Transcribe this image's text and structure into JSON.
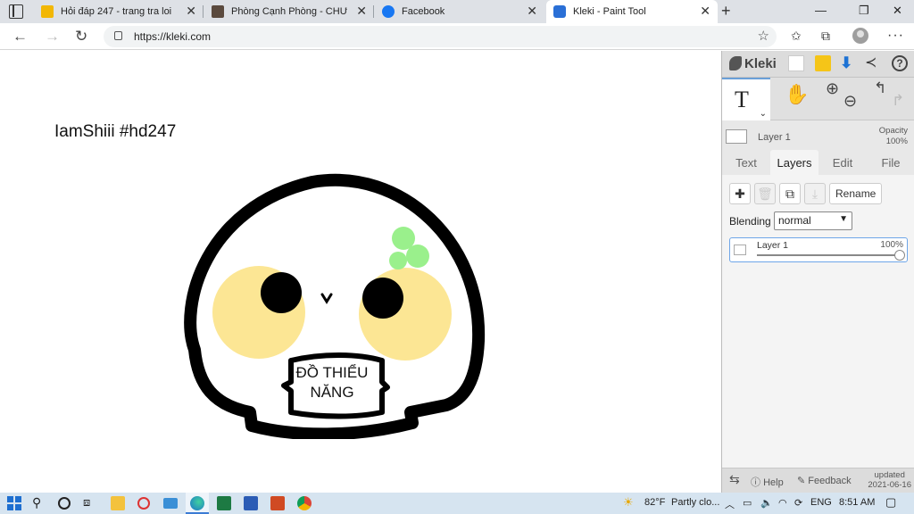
{
  "browser": {
    "tabs": [
      {
        "title": "Hỏi đáp 247 - trang tra loi",
        "favicon": "hoidap-logo-icon",
        "active": false
      },
      {
        "title": "Phòng Cạnh Phòng - CHƯƠNG",
        "favicon": "thumbnail-icon",
        "active": false
      },
      {
        "title": "Facebook",
        "favicon": "facebook-icon",
        "active": false
      },
      {
        "title": "Kleki - Paint Tool",
        "favicon": "kleki-icon",
        "active": true
      }
    ],
    "new_tab_label": "+",
    "url": "https://kleki.com"
  },
  "canvas": {
    "text": "IamShiii #hd247",
    "sign_line1": "ĐỒ THIỂU",
    "sign_line2": "NĂNG",
    "colors": {
      "cheek": "#fce694",
      "sprout": "#9af08c",
      "outline": "#000000"
    }
  },
  "panel": {
    "brand": "Kleki",
    "top_layer_name": "Layer 1",
    "opacity_label": "Opacity",
    "opacity_value": "100%",
    "subtabs": [
      "Text",
      "Layers",
      "Edit",
      "File"
    ],
    "active_subtab": "Layers",
    "rename_label": "Rename",
    "blending_label": "Blending",
    "blending_value": "normal",
    "layer": {
      "name": "Layer 1",
      "opacity": "100%"
    },
    "footer": {
      "help": "Help",
      "feedback": "Feedback",
      "updated_label": "updated",
      "updated_date": "2021-06-16"
    }
  },
  "taskbar": {
    "weather_temp": "82°F",
    "weather_text": "Partly clo...",
    "lang": "ENG",
    "time": "8:51 AM"
  }
}
